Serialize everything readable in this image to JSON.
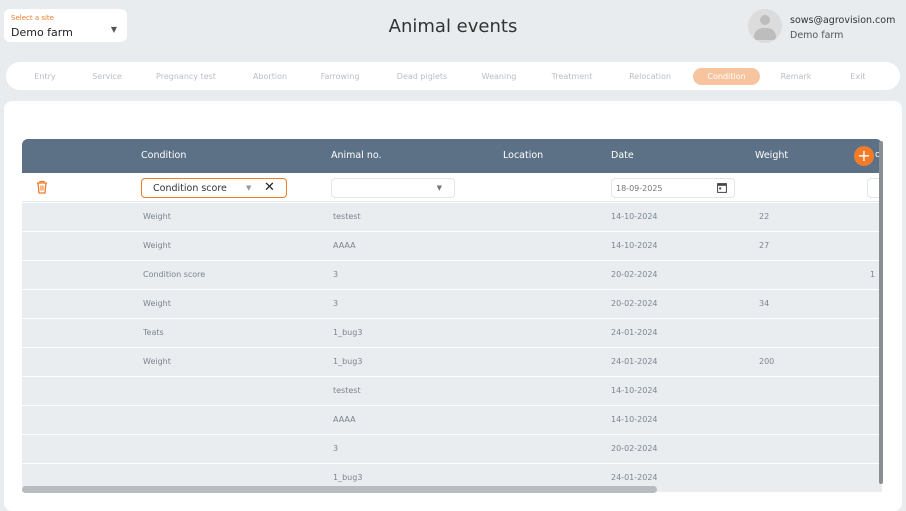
{
  "site": {
    "label": "Select a site",
    "value": "Demo farm"
  },
  "page_title": "Animal events",
  "user": {
    "email": "sows@agrovision.com",
    "farm": "Demo farm"
  },
  "tabs": [
    {
      "label": "Entry",
      "active": false
    },
    {
      "label": "Service",
      "active": false
    },
    {
      "label": "Pregnancy test",
      "active": false
    },
    {
      "label": "Abortion",
      "active": false
    },
    {
      "label": "Farrowing",
      "active": false
    },
    {
      "label": "Dead piglets",
      "active": false
    },
    {
      "label": "Weaning",
      "active": false
    },
    {
      "label": "Treatment",
      "active": false
    },
    {
      "label": "Relocation",
      "active": false
    },
    {
      "label": "Condition",
      "active": true
    },
    {
      "label": "Remark",
      "active": false
    },
    {
      "label": "Exit",
      "active": false
    }
  ],
  "grid": {
    "headers": [
      "Condition",
      "Animal no.",
      "Location",
      "Date",
      "Weight"
    ],
    "cut_header": "o",
    "edit_row": {
      "condition": "Condition score",
      "animal": "",
      "date": "18-09-2025"
    },
    "rows": [
      {
        "condition": "Weight",
        "animal": "testest",
        "date": "14-10-2024",
        "weight": "22",
        "extra": ""
      },
      {
        "condition": "Weight",
        "animal": "AAAA",
        "date": "14-10-2024",
        "weight": "27",
        "extra": ""
      },
      {
        "condition": "Condition score",
        "animal": "3",
        "date": "20-02-2024",
        "weight": "",
        "extra": "1"
      },
      {
        "condition": "Weight",
        "animal": "3",
        "date": "20-02-2024",
        "weight": "34",
        "extra": ""
      },
      {
        "condition": "Teats",
        "animal": "1_bug3",
        "date": "24-01-2024",
        "weight": "",
        "extra": ""
      },
      {
        "condition": "Weight",
        "animal": "1_bug3",
        "date": "24-01-2024",
        "weight": "200",
        "extra": ""
      },
      {
        "condition": "",
        "animal": "testest",
        "date": "14-10-2024",
        "weight": "",
        "extra": ""
      },
      {
        "condition": "",
        "animal": "AAAA",
        "date": "14-10-2024",
        "weight": "",
        "extra": ""
      },
      {
        "condition": "",
        "animal": "3",
        "date": "20-02-2024",
        "weight": "",
        "extra": ""
      },
      {
        "condition": "",
        "animal": "1_bug3",
        "date": "24-01-2024",
        "weight": "",
        "extra": ""
      }
    ]
  },
  "colors": {
    "accent": "#f07c2a",
    "header_bg": "#5c7186",
    "row_bg": "#e9edf0",
    "active_tab": "#f7c4a0"
  }
}
